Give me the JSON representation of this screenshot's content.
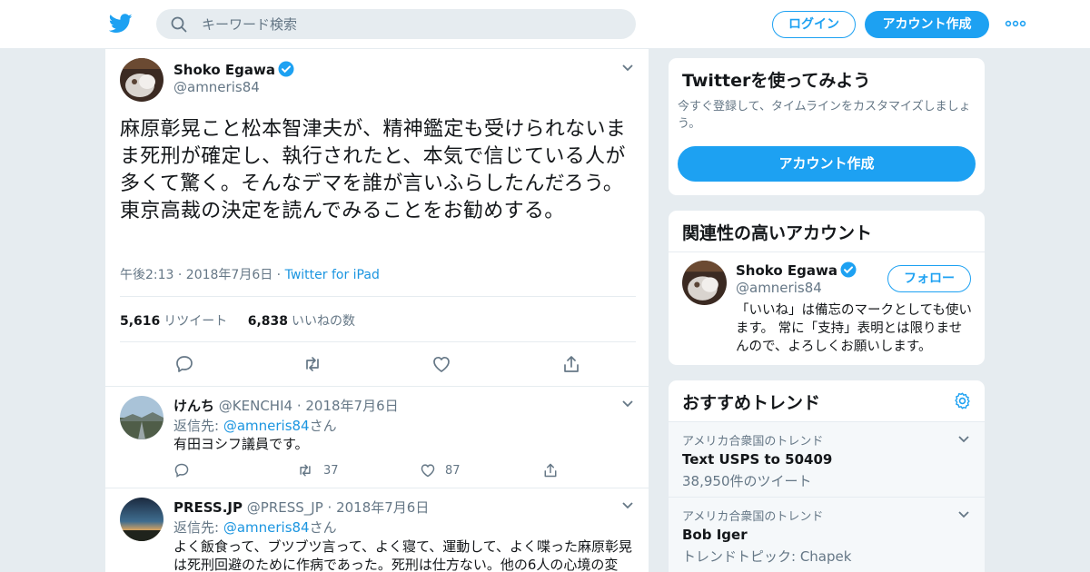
{
  "header": {
    "search_placeholder": "キーワード検索",
    "login_label": "ログイン",
    "signup_label": "アカウント作成"
  },
  "tweet": {
    "author_name": "Shoko Egawa",
    "author_handle": "@amneris84",
    "text": "麻原彰晃こと松本智津夫が、精神鑑定も受けられないまま死刑が確定し、執行されたと、本気で信じている人が多くて驚く。そんなデマを誰が言いふらしたんだろう。東京高裁の決定を読んでみることをお勧めする。",
    "time": "午後2:13 · 2018年7月6日 · ",
    "source": "Twitter for iPad",
    "retweet_count": "5,616",
    "retweet_label": "リツイート",
    "like_count": "6,838",
    "like_label": "いいねの数"
  },
  "replies": [
    {
      "name": "けんち",
      "handle": "@KENCHI4",
      "date": "· 2018年7月6日",
      "reply_to_prefix": "返信先: ",
      "reply_to_handle": "@amneris84",
      "reply_to_suffix": "さん",
      "text": "有田ヨシフ議員です。",
      "retweets": "37",
      "likes": "87"
    },
    {
      "name": "PRESS.JP",
      "handle": "@PRESS_JP",
      "date": "· 2018年7月6日",
      "reply_to_prefix": "返信先: ",
      "reply_to_handle": "@amneris84",
      "reply_to_suffix": "さん",
      "text": "よく飯食って、ブツブツ言って、よく寝て、運動して、よく喋った麻原彰晃は死刑回避のために作病であった。死刑は仕方ない。他の6人の心境の変"
    }
  ],
  "sidebar": {
    "try_title": "Twitterを使ってみよう",
    "try_desc": "今すぐ登録して、タイムラインをカスタマイズしましょう。",
    "try_button": "アカウント作成",
    "related_title": "関連性の高いアカウント",
    "related_name": "Shoko Egawa",
    "related_handle": "@amneris84",
    "follow_label": "フォロー",
    "related_bio": "「いいね」は備忘のマークとしても使います。 常に「支持」表明とは限りませんので、よろしくお願いします。",
    "trends_title": "おすすめトレンド",
    "trends": [
      {
        "location": "アメリカ合衆国のトレンド",
        "name": "Text USPS to 50409",
        "count": "38,950件のツイート"
      },
      {
        "location": "アメリカ合衆国のトレンド",
        "name": "Bob Iger",
        "count": "トレンドトピック: Chapek"
      }
    ]
  },
  "colors": {
    "brand": "#1da1f2",
    "link": "#1b95e0",
    "muted": "#657786",
    "background": "#e6ecf0"
  }
}
